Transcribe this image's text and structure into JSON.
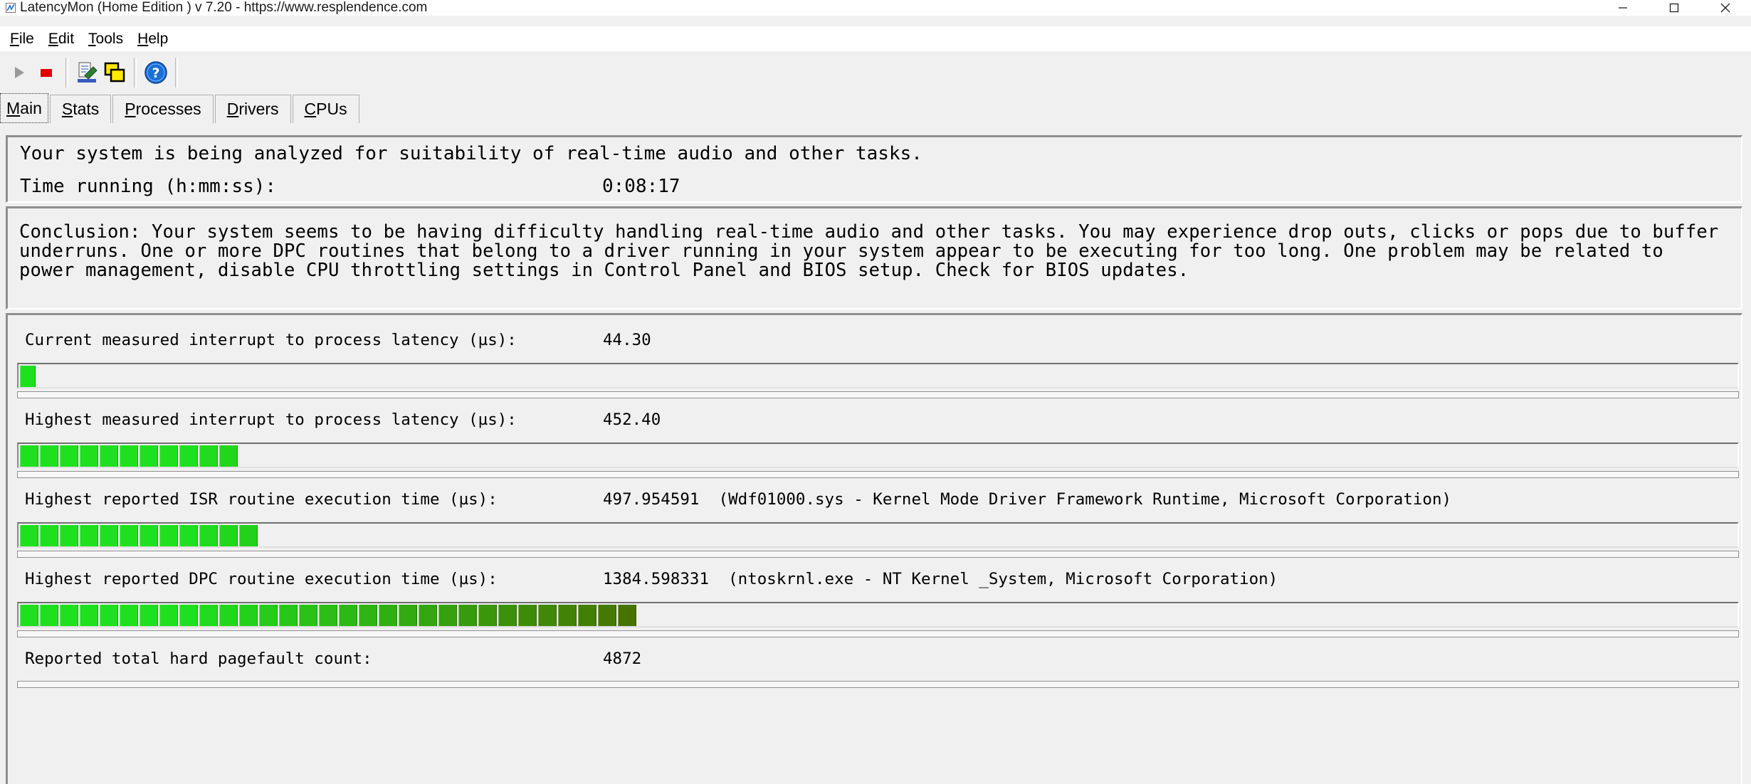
{
  "window": {
    "title": "LatencyMon  (Home Edition )  v 7.20 - https://www.resplendence.com",
    "controls": [
      "—",
      "☐",
      "✕"
    ]
  },
  "menu": [
    {
      "key": "F",
      "rest": "ile"
    },
    {
      "key": "E",
      "rest": "dit"
    },
    {
      "key": "T",
      "rest": "ools"
    },
    {
      "key": "H",
      "rest": "elp"
    }
  ],
  "toolbar": {
    "icons": [
      "play-icon",
      "stop-icon",
      "submit-icon",
      "windows-icon",
      "help-icon"
    ],
    "colors": {
      "stop": "#e00000",
      "help": "#1a6fd6"
    }
  },
  "tabs": [
    {
      "key": "M",
      "rest": "ain",
      "active": true
    },
    {
      "key": "S",
      "rest": "tats",
      "active": false
    },
    {
      "key": "P",
      "rest": "rocesses",
      "active": false
    },
    {
      "key": "D",
      "rest": "rivers",
      "active": false
    },
    {
      "key": "C",
      "rest": "PUs",
      "active": false
    }
  ],
  "status": {
    "line1": "Your system is being analyzed for suitability of real-time audio and other tasks.",
    "time_label": "Time running (h:mm:ss):",
    "time_value": "0:08:17"
  },
  "conclusion": "Conclusion: Your system seems to be having difficulty handling real-time audio and other tasks. You may experience drop outs, clicks or pops due to buffer underruns. One or more DPC routines that belong to a driver running in your system appear to be executing for too long. One problem may be related to power management, disable CPU throttling settings in Control Panel and BIOS setup. Check for BIOS updates.",
  "metrics": [
    {
      "label": "Current measured interrupt to process latency (µs):",
      "value": "44.30",
      "segments": 1
    },
    {
      "label": "Highest measured interrupt to process latency (µs):",
      "value": "452.40",
      "segments": 11
    },
    {
      "label": "Highest reported ISR routine execution time (µs):",
      "value": "497.954591  (Wdf01000.sys - Kernel Mode Driver Framework Runtime, Microsoft Corporation)",
      "segments": 12
    },
    {
      "label": "Highest reported DPC routine execution time (µs):",
      "value": "1384.598331  (ntoskrnl.exe - NT Kernel _System, Microsoft Corporation)",
      "segments": 31
    },
    {
      "label": "Reported total hard pagefault count:",
      "value": "4872",
      "segments": 0
    }
  ],
  "bar_colors": {
    "green": "#1ee01e",
    "olive": "#4a6a00"
  }
}
